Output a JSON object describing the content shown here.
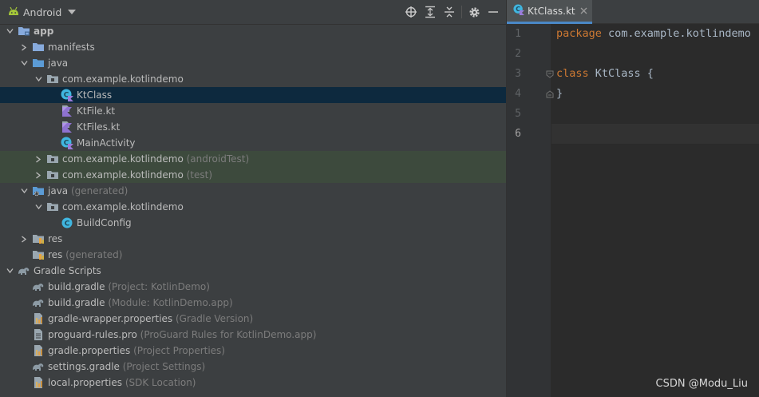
{
  "project_panel": {
    "view_name": "Android",
    "header_icons": [
      "android-icon",
      "chevron-down-icon",
      "locate-icon",
      "expand-all-icon",
      "collapse-all-icon",
      "gear-icon",
      "minimize-icon"
    ],
    "tree": [
      {
        "label": "app",
        "hint": "",
        "level": 0,
        "arrow": "down",
        "icon": "module-folder-icon",
        "bold": true,
        "state": ""
      },
      {
        "label": "manifests",
        "hint": "",
        "level": 1,
        "arrow": "right",
        "icon": "folder-icon",
        "bold": false,
        "state": ""
      },
      {
        "label": "java",
        "hint": "",
        "level": 1,
        "arrow": "down",
        "icon": "source-folder-icon",
        "bold": false,
        "state": ""
      },
      {
        "label": "com.example.kotlindemo",
        "hint": "",
        "level": 2,
        "arrow": "down",
        "icon": "package-icon",
        "bold": false,
        "state": ""
      },
      {
        "label": "KtClass",
        "hint": "",
        "level": 3,
        "arrow": "",
        "icon": "kotlin-class-icon",
        "bold": false,
        "state": "selected"
      },
      {
        "label": "KtFile.kt",
        "hint": "",
        "level": 3,
        "arrow": "",
        "icon": "kotlin-file-icon",
        "bold": false,
        "state": ""
      },
      {
        "label": "KtFiles.kt",
        "hint": "",
        "level": 3,
        "arrow": "",
        "icon": "kotlin-file-icon",
        "bold": false,
        "state": ""
      },
      {
        "label": "MainActivity",
        "hint": "",
        "level": 3,
        "arrow": "",
        "icon": "kotlin-class-icon",
        "bold": false,
        "state": ""
      },
      {
        "label": "com.example.kotlindemo",
        "hint": "(androidTest)",
        "level": 2,
        "arrow": "right",
        "icon": "package-icon",
        "bold": false,
        "state": "test"
      },
      {
        "label": "com.example.kotlindemo",
        "hint": "(test)",
        "level": 2,
        "arrow": "right",
        "icon": "package-icon",
        "bold": false,
        "state": "test"
      },
      {
        "label": "java",
        "hint": "(generated)",
        "level": 1,
        "arrow": "down",
        "icon": "generated-source-folder-icon",
        "bold": false,
        "state": ""
      },
      {
        "label": "com.example.kotlindemo",
        "hint": "",
        "level": 2,
        "arrow": "down",
        "icon": "package-icon",
        "bold": false,
        "state": ""
      },
      {
        "label": "BuildConfig",
        "hint": "",
        "level": 3,
        "arrow": "",
        "icon": "java-class-icon",
        "bold": false,
        "state": ""
      },
      {
        "label": "res",
        "hint": "",
        "level": 1,
        "arrow": "right",
        "icon": "resources-folder-icon",
        "bold": false,
        "state": ""
      },
      {
        "label": "res",
        "hint": "(generated)",
        "level": 1,
        "arrow": "",
        "icon": "resources-folder-icon",
        "bold": false,
        "state": ""
      },
      {
        "label": "Gradle Scripts",
        "hint": "",
        "level": 0,
        "arrow": "down",
        "icon": "gradle-icon",
        "bold": false,
        "state": ""
      },
      {
        "label": "build.gradle",
        "hint": "(Project: KotlinDemo)",
        "level": 1,
        "arrow": "",
        "icon": "gradle-icon",
        "bold": false,
        "state": ""
      },
      {
        "label": "build.gradle",
        "hint": "(Module: KotlinDemo.app)",
        "level": 1,
        "arrow": "",
        "icon": "gradle-icon",
        "bold": false,
        "state": ""
      },
      {
        "label": "gradle-wrapper.properties",
        "hint": "(Gradle Version)",
        "level": 1,
        "arrow": "",
        "icon": "properties-file-icon",
        "bold": false,
        "state": ""
      },
      {
        "label": "proguard-rules.pro",
        "hint": "(ProGuard Rules for KotlinDemo.app)",
        "level": 1,
        "arrow": "",
        "icon": "text-file-icon",
        "bold": false,
        "state": ""
      },
      {
        "label": "gradle.properties",
        "hint": "(Project Properties)",
        "level": 1,
        "arrow": "",
        "icon": "properties-file-icon",
        "bold": false,
        "state": ""
      },
      {
        "label": "settings.gradle",
        "hint": "(Project Settings)",
        "level": 1,
        "arrow": "",
        "icon": "gradle-icon",
        "bold": false,
        "state": ""
      },
      {
        "label": "local.properties",
        "hint": "(SDK Location)",
        "level": 1,
        "arrow": "",
        "icon": "properties-file-icon",
        "bold": false,
        "state": ""
      }
    ]
  },
  "editor": {
    "tab": {
      "label": "KtClass.kt",
      "icon": "kotlin-class-icon"
    },
    "current_line": 6,
    "lines": [
      {
        "num": "1",
        "tokens": [
          {
            "t": "package ",
            "k": "kw"
          },
          {
            "t": "com.example.kotlindemo",
            "k": "plain"
          }
        ],
        "fold": ""
      },
      {
        "num": "2",
        "tokens": [],
        "fold": ""
      },
      {
        "num": "3",
        "tokens": [
          {
            "t": "class ",
            "k": "kw"
          },
          {
            "t": "KtClass {",
            "k": "plain"
          }
        ],
        "fold": "open"
      },
      {
        "num": "4",
        "tokens": [
          {
            "t": "}",
            "k": "plain"
          }
        ],
        "fold": "close"
      },
      {
        "num": "5",
        "tokens": [],
        "fold": ""
      },
      {
        "num": "6",
        "tokens": [],
        "fold": ""
      }
    ]
  },
  "watermark": "CSDN @Modu_Liu",
  "colors": {
    "panel_bg": "#3c3f41",
    "editor_bg": "#2b2b2b",
    "selection": "#0d293e",
    "test_tint": "#3d4a3d",
    "keyword": "#cc7832",
    "tab_underline": "#4a88c7"
  }
}
